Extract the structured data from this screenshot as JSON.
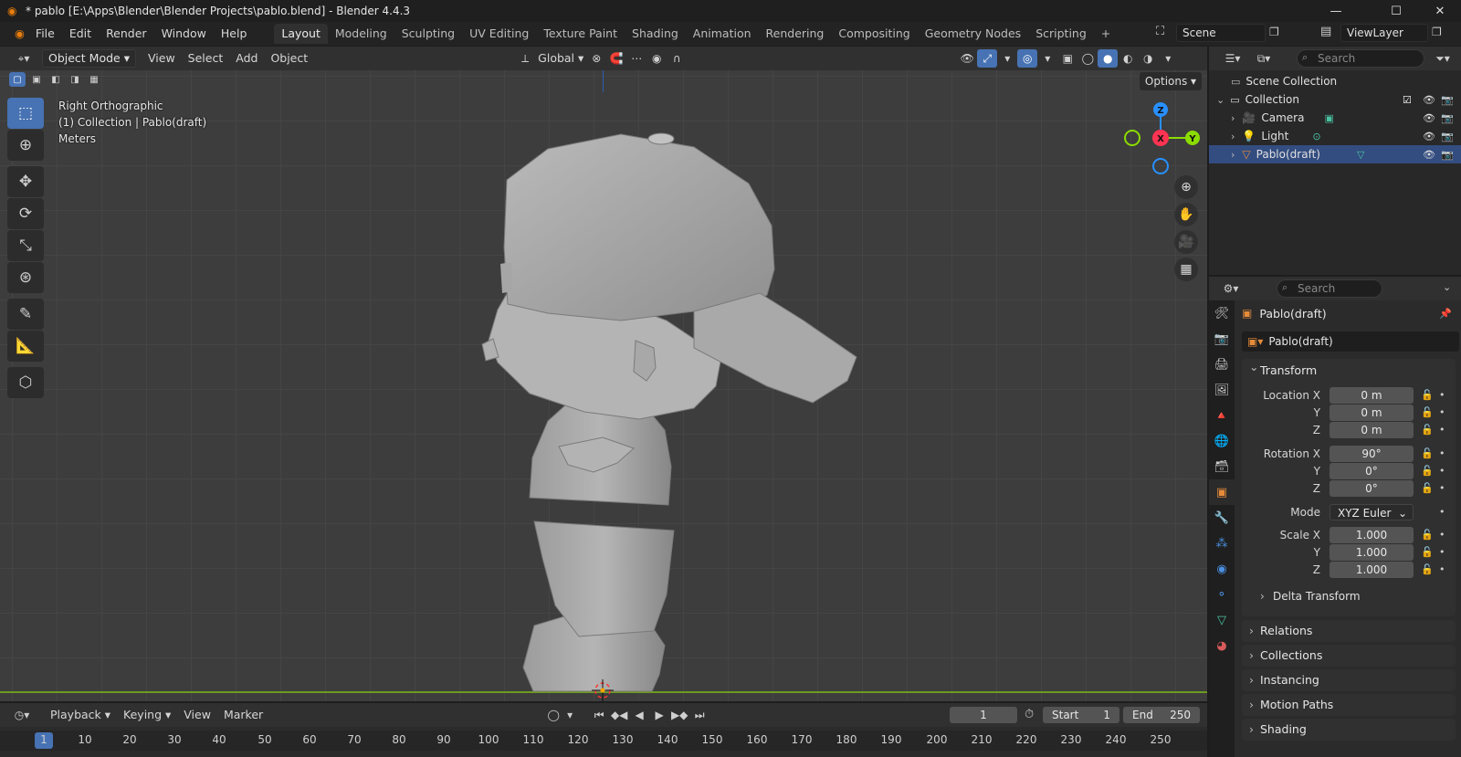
{
  "window": {
    "title": "* pablo [E:\\Apps\\Blender\\Blender Projects\\pablo.blend] - Blender 4.4.3",
    "controls": {
      "minimize": "—",
      "maximize": "☐",
      "close": "✕"
    }
  },
  "menubar": {
    "items": [
      "File",
      "Edit",
      "Render",
      "Window",
      "Help"
    ],
    "workspaces": [
      "Layout",
      "Modeling",
      "Sculpting",
      "UV Editing",
      "Texture Paint",
      "Shading",
      "Animation",
      "Rendering",
      "Compositing",
      "Geometry Nodes",
      "Scripting"
    ],
    "active_workspace": "Layout",
    "add_tab": "+",
    "scene": "Scene",
    "view_layer": "ViewLayer"
  },
  "viewport": {
    "mode": "Object Mode",
    "menus": [
      "View",
      "Select",
      "Add",
      "Object"
    ],
    "orientation": "Global",
    "options_label": "Options",
    "overlay_lines": [
      "Right Orthographic",
      "(1) Collection | Pablo(draft)",
      "Meters"
    ],
    "gizmo": {
      "z": "Z",
      "x": "X",
      "y": "Y"
    },
    "tools": [
      "select-box",
      "cursor",
      "move",
      "rotate",
      "scale",
      "transform",
      "annotate",
      "measure",
      "add-cube"
    ]
  },
  "timeline": {
    "menus": [
      "Playback",
      "Keying",
      "View",
      "Marker"
    ],
    "current_frame": "1",
    "start_label": "Start",
    "start": "1",
    "end_label": "End",
    "end": "250",
    "ruler": [
      "1",
      "10",
      "20",
      "30",
      "40",
      "50",
      "60",
      "70",
      "80",
      "90",
      "100",
      "110",
      "120",
      "130",
      "140",
      "150",
      "160",
      "170",
      "180",
      "190",
      "200",
      "210",
      "220",
      "230",
      "240",
      "250"
    ]
  },
  "outliner": {
    "search_placeholder": "Search",
    "scene_collection": "Scene Collection",
    "collection": "Collection",
    "items": [
      {
        "name": "Camera",
        "icon": "camera-icon"
      },
      {
        "name": "Light",
        "icon": "light-icon"
      },
      {
        "name": "Pablo(draft)",
        "icon": "mesh-icon",
        "selected": true
      }
    ]
  },
  "properties": {
    "search_placeholder": "Search",
    "object_name": "Pablo(draft)",
    "object_field": "Pablo(draft)",
    "transform": {
      "title": "Transform",
      "location": {
        "label": "Location X",
        "x": "0 m",
        "y": "0 m",
        "z": "0 m"
      },
      "rotation": {
        "label": "Rotation X",
        "x": "90°",
        "y": "0°",
        "z": "0°"
      },
      "mode_label": "Mode",
      "mode": "XYZ Euler",
      "scale": {
        "label": "Scale X",
        "x": "1.000",
        "y": "1.000",
        "z": "1.000"
      },
      "axis_y": "Y",
      "axis_z": "Z",
      "delta": "Delta Transform"
    },
    "panels": [
      "Relations",
      "Collections",
      "Instancing",
      "Motion Paths",
      "Shading"
    ]
  },
  "colors": {
    "accent": "#4772b3",
    "x_axis": "#ff3352",
    "y_axis": "#8bdc00",
    "z_axis": "#2890ff",
    "selected_row": "#334d80"
  }
}
